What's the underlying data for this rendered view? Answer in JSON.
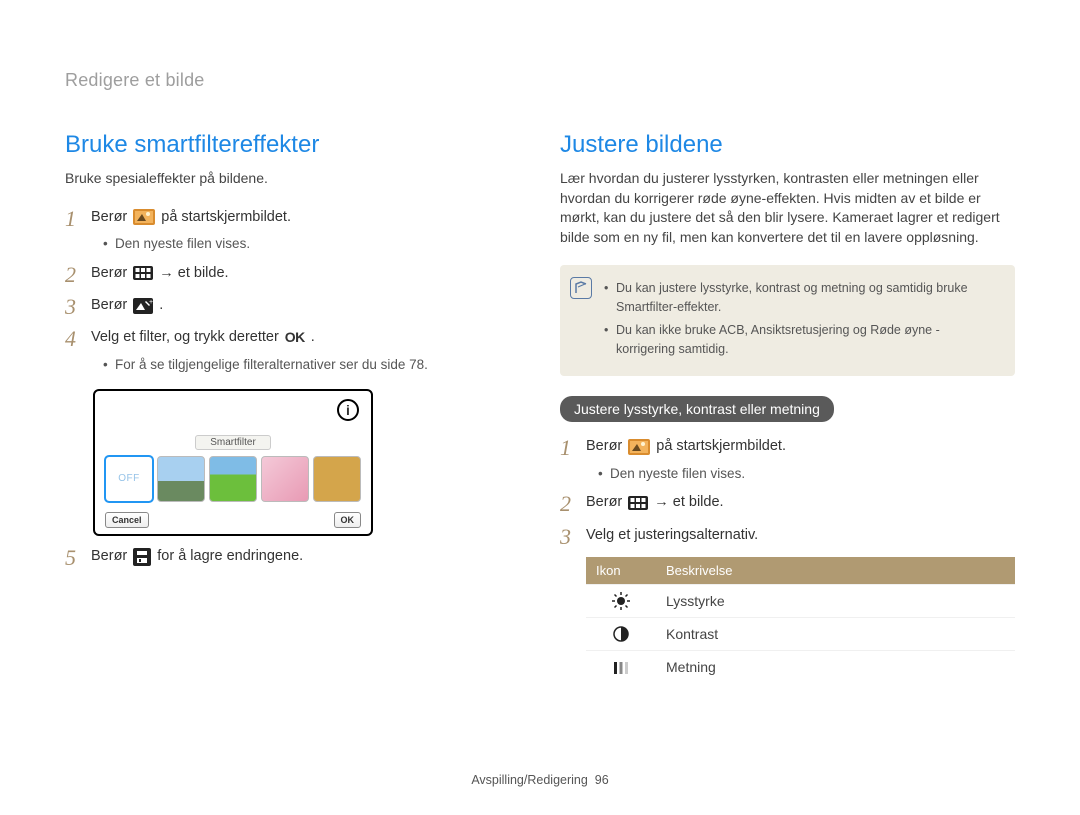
{
  "breadcrumb": "Redigere et bilde",
  "left": {
    "title": "Bruke smartfiltereffekter",
    "intro": "Bruke spesialeffekter på bildene.",
    "steps": [
      {
        "num": "1",
        "pre": "Berør",
        "post": "på startskjermbildet.",
        "bullets": [
          "Den nyeste filen vises."
        ]
      },
      {
        "num": "2",
        "pre": "Berør",
        "post": "→ et bilde."
      },
      {
        "num": "3",
        "pre": "Berør",
        "post": "."
      },
      {
        "num": "4",
        "text_pre": "Velg et filter, og trykk deretter",
        "text_post": ".",
        "bullets": [
          "For å se tilgjengelige filteralternativer ser du side 78."
        ]
      },
      {
        "num": "5",
        "pre": "Berør",
        "post": "for å lagre endringene."
      }
    ],
    "screenshot": {
      "label": "Smartfilter",
      "off": "OFF",
      "cancel": "Cancel",
      "ok": "OK"
    }
  },
  "right": {
    "title": "Justere bildene",
    "intro": "Lær hvordan du justerer lysstyrken, kontrasten eller metningen eller hvordan du korrigerer røde øyne-effekten. Hvis midten av et bilde er mørkt, kan du justere det så den blir lysere. Kameraet lagrer et redigert bilde som en ny fil, men kan konvertere det til en lavere oppløsning.",
    "notes": [
      "Du kan justere lysstyrke, kontrast og metning og samtidig bruke Smartfilter-effekter.",
      "Du kan ikke bruke ACB, Ansiktsretusjering og Røde øyne - korrigering samtidig."
    ],
    "subheader": "Justere lysstyrke, kontrast eller metning",
    "steps": [
      {
        "num": "1",
        "pre": "Berør",
        "post": "på startskjermbildet.",
        "bullets": [
          "Den nyeste filen vises."
        ]
      },
      {
        "num": "2",
        "pre": "Berør",
        "post": "→ et bilde."
      },
      {
        "num": "3",
        "text": "Velg et justeringsalternativ."
      }
    ],
    "table": {
      "h1": "Ikon",
      "h2": "Beskrivelse",
      "rows": [
        {
          "label": "Lysstyrke"
        },
        {
          "label": "Kontrast"
        },
        {
          "label": "Metning"
        }
      ]
    }
  },
  "footer": {
    "section": "Avspilling/Redigering",
    "page": "96"
  }
}
